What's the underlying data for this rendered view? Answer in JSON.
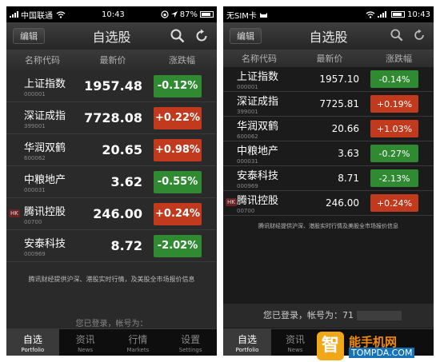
{
  "left": {
    "status": {
      "carrier": "中国联通",
      "time": "10:43",
      "battery": "87%"
    },
    "header": {
      "edit": "编辑",
      "title": "自选股"
    },
    "columns": {
      "name": "名称代码",
      "price": "最新价",
      "change": "涨跌幅"
    },
    "rows": [
      {
        "name": "上证指数",
        "code": "000001",
        "price": "1957.48",
        "change": "-0.12%",
        "dir": "down",
        "hk": ""
      },
      {
        "name": "深证成指",
        "code": "399001",
        "price": "7728.08",
        "change": "+0.22%",
        "dir": "up",
        "hk": ""
      },
      {
        "name": "华润双鹤",
        "code": "600062",
        "price": "20.65",
        "change": "+0.98%",
        "dir": "up",
        "hk": ""
      },
      {
        "name": "中粮地产",
        "code": "000031",
        "price": "3.62",
        "change": "-0.55%",
        "dir": "down",
        "hk": ""
      },
      {
        "name": "腾讯控股",
        "code": "00700",
        "price": "246.00",
        "change": "+0.24%",
        "dir": "up",
        "hk": "HK"
      },
      {
        "name": "安泰科技",
        "code": "000969",
        "price": "8.72",
        "change": "-2.02%",
        "dir": "down",
        "hk": ""
      }
    ],
    "disclaimer": "腾讯财经提供沪深、港股实时行情，及美股全市场报价信息",
    "login": "您已登录，帐号为：",
    "tabs": [
      {
        "label": "自选",
        "sub": "Portfolio"
      },
      {
        "label": "资讯",
        "sub": "News"
      },
      {
        "label": "行情",
        "sub": "Markets"
      },
      {
        "label": "设置",
        "sub": "Settings"
      }
    ]
  },
  "right": {
    "status": {
      "carrier": "无SIM卡",
      "time": "10:43"
    },
    "header": {
      "edit": "编辑",
      "title": "自选股"
    },
    "columns": {
      "name": "名称代码",
      "price": "最新价",
      "change": "涨跌幅"
    },
    "rows": [
      {
        "name": "上证指数",
        "code": "000001",
        "price": "1957.10",
        "change": "-0.14%",
        "dir": "down",
        "hk": ""
      },
      {
        "name": "深证成指",
        "code": "399001",
        "price": "7725.81",
        "change": "+0.19%",
        "dir": "up",
        "hk": ""
      },
      {
        "name": "华润双鹤",
        "code": "600062",
        "price": "20.66",
        "change": "+1.03%",
        "dir": "up",
        "hk": ""
      },
      {
        "name": "中粮地产",
        "code": "000031",
        "price": "3.63",
        "change": "-0.27%",
        "dir": "down",
        "hk": ""
      },
      {
        "name": "安泰科技",
        "code": "000969",
        "price": "8.71",
        "change": "-2.13%",
        "dir": "down",
        "hk": ""
      },
      {
        "name": "腾讯控股",
        "code": "00700",
        "price": "246.00",
        "change": "+0.24%",
        "dir": "up",
        "hk": "HK"
      }
    ],
    "disclaimer": "腾讯财经提供沪深、港股实时行情及美股全市场报价信息",
    "login": "您已登录，帐号为：71",
    "tabs": [
      {
        "label": "自选",
        "sub": "Portfolio"
      },
      {
        "label": "资讯",
        "sub": "News"
      }
    ]
  },
  "watermark": {
    "logo": "智",
    "name": "能手机网",
    "url": "TOMPDA.COM"
  },
  "colors": {
    "down": "#2f8a32",
    "up": "#c23a1e"
  },
  "icons": [
    "search-icon",
    "refresh-icon",
    "wifi-icon",
    "battery-icon"
  ]
}
